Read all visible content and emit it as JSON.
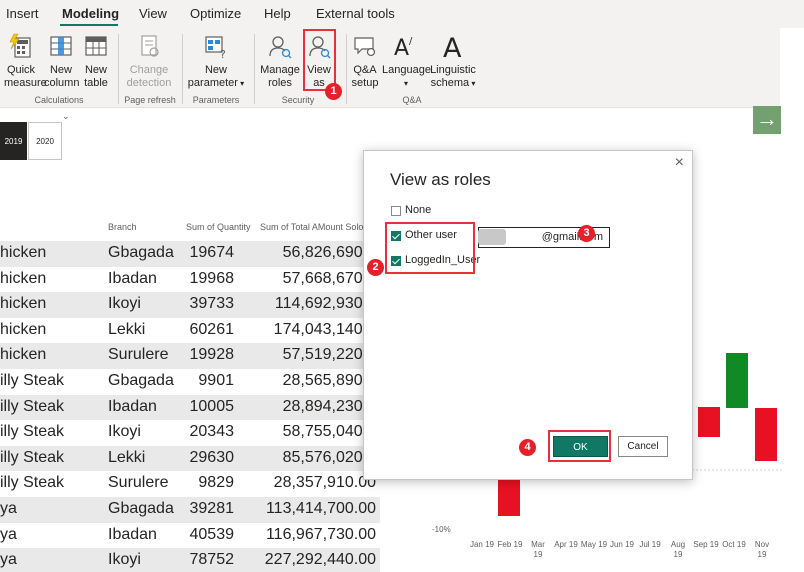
{
  "ribbon": {
    "tabs": [
      {
        "label": "Insert"
      },
      {
        "label": "Modeling"
      },
      {
        "label": "View"
      },
      {
        "label": "Optimize"
      },
      {
        "label": "Help"
      },
      {
        "label": "External tools"
      }
    ],
    "groups": {
      "calculations": {
        "label": "Calculations",
        "quick_measure": [
          "Quick",
          "measure"
        ],
        "new_column": [
          "New",
          "column"
        ],
        "new_table": [
          "New",
          "table"
        ]
      },
      "page_refresh": {
        "label": "Page refresh",
        "change_detection": [
          "Change",
          "detection"
        ]
      },
      "parameters": {
        "label": "Parameters",
        "new_parameter": [
          "New",
          "parameter"
        ]
      },
      "security": {
        "label": "Security",
        "manage_roles": [
          "Manage",
          "roles"
        ],
        "view_as": [
          "View",
          "as"
        ]
      },
      "qa": {
        "label": "Q&A",
        "qa_setup": [
          "Q&A",
          "setup"
        ],
        "language": [
          "Language",
          ""
        ],
        "linguistic_schema": [
          "Linguistic",
          "schema"
        ]
      }
    }
  },
  "badges": [
    "1",
    "2",
    "3",
    "4"
  ],
  "slicer": {
    "years": [
      "2019",
      "2020"
    ]
  },
  "table": {
    "headers": {
      "branch": "Branch",
      "quantity": "Sum of Quantity",
      "amount": "Sum of Total AMount Solo"
    },
    "rows": [
      {
        "product": "hicken",
        "branch": "Gbagada",
        "qty": "19674",
        "amount": "56,826,690.0"
      },
      {
        "product": "hicken",
        "branch": "Ibadan",
        "qty": "19968",
        "amount": "57,668,670.0"
      },
      {
        "product": "hicken",
        "branch": "Ikoyi",
        "qty": "39733",
        "amount": "114,692,930.0"
      },
      {
        "product": "hicken",
        "branch": "Lekki",
        "qty": "60261",
        "amount": "174,043,140.0"
      },
      {
        "product": "hicken",
        "branch": "Surulere",
        "qty": "19928",
        "amount": "57,519,220.0"
      },
      {
        "product": "illy Steak",
        "branch": "Gbagada",
        "qty": "9901",
        "amount": "28,565,890.0"
      },
      {
        "product": "illy Steak",
        "branch": "Ibadan",
        "qty": "10005",
        "amount": "28,894,230.0"
      },
      {
        "product": "illy Steak",
        "branch": "Ikoyi",
        "qty": "20343",
        "amount": "58,755,040.0"
      },
      {
        "product": "illy Steak",
        "branch": "Lekki",
        "qty": "29630",
        "amount": "85,576,020.0"
      },
      {
        "product": "illy Steak",
        "branch": "Surulere",
        "qty": "9829",
        "amount": "28,357,910.00"
      },
      {
        "product": "ya",
        "branch": "Gbagada",
        "qty": "39281",
        "amount": "113,414,700.00"
      },
      {
        "product": "ya",
        "branch": "Ibadan",
        "qty": "40539",
        "amount": "116,967,730.00"
      },
      {
        "product": "ya",
        "branch": "Ikoyi",
        "qty": "78752",
        "amount": "227,292,440.00"
      }
    ]
  },
  "dialog": {
    "title": "View as roles",
    "close": "×",
    "options": [
      {
        "label": "None",
        "checked": false
      },
      {
        "label": "Other user",
        "checked": true
      },
      {
        "label": "LoggedIn_User",
        "checked": true
      }
    ],
    "user_value": "@gmail.com",
    "ok": "OK",
    "cancel": "Cancel"
  },
  "chart": {
    "y_tick": "-10%",
    "months": [
      "Jan 19",
      "Feb 19",
      "Mar 19",
      "Apr 19",
      "May 19",
      "Jun 19",
      "Jul 19",
      "Aug 19",
      "Sep 19",
      "Oct 19",
      "Nov 19"
    ],
    "colors": {
      "positive": "#118a26",
      "negative": "#e81123"
    }
  }
}
